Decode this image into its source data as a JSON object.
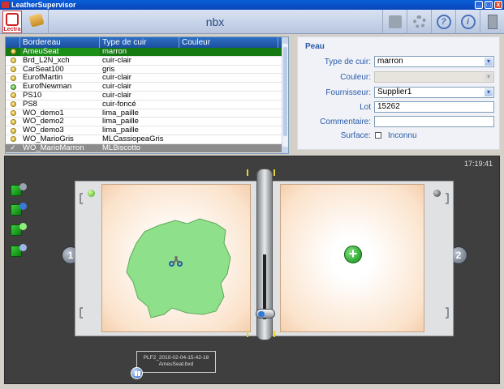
{
  "window": {
    "title": "LeatherSupervisor",
    "min": "_",
    "max": "□",
    "close": "x"
  },
  "header": {
    "logo_text": "Lectra",
    "title": "nbx",
    "icons": [
      "scale-icon",
      "gear-icon",
      "help-icon",
      "info-icon",
      "exit-door-icon"
    ],
    "help_glyph": "?",
    "info_glyph": "i"
  },
  "list": {
    "columns": [
      "Bordereau",
      "Type de cuir",
      "Couleur"
    ],
    "rows": [
      {
        "bordereau": "AmeuSeat",
        "type": "marron",
        "couleur": "",
        "status": "yellow"
      },
      {
        "bordereau": "Brd_L2N_xch",
        "type": "cuir-clair",
        "couleur": "",
        "status": "yellow"
      },
      {
        "bordereau": "CarSeat100",
        "type": "gris",
        "couleur": "",
        "status": "yellow"
      },
      {
        "bordereau": "EurofMartin",
        "type": "cuir-clair",
        "couleur": "",
        "status": "yellow"
      },
      {
        "bordereau": "EurofNewman",
        "type": "cuir-clair",
        "couleur": "",
        "status": "green"
      },
      {
        "bordereau": "PS10",
        "type": "cuir-clair",
        "couleur": "",
        "status": "yellow"
      },
      {
        "bordereau": "PS8",
        "type": "cuir-foncé",
        "couleur": "",
        "status": "yellow"
      },
      {
        "bordereau": "WO_demo1",
        "type": "lima_paille",
        "couleur": "",
        "status": "yellow"
      },
      {
        "bordereau": "WO_demo2",
        "type": "lima_paille",
        "couleur": "",
        "status": "yellow"
      },
      {
        "bordereau": "WO_demo3",
        "type": "lima_paille",
        "couleur": "",
        "status": "yellow"
      },
      {
        "bordereau": "WO_MarioGris",
        "type": "MLCassiopeaGris",
        "couleur": "",
        "status": "yellow"
      },
      {
        "bordereau": "WO_MarioMarron",
        "type": "MLBiscotto",
        "couleur": "",
        "status": "check"
      }
    ],
    "check_glyph": "✓"
  },
  "peau": {
    "title": "Peau",
    "type_label": "Type de cuir:",
    "type_value": "marron",
    "couleur_label": "Couleur:",
    "couleur_value": "",
    "fournisseur_label": "Fournisseur:",
    "fournisseur_value": "Supplier1",
    "lot_label": "Lot",
    "lot_value": "15262",
    "commentaire_label": "Commentaire:",
    "commentaire_value": "",
    "surface_label": "Surface:",
    "surface_value": "Inconnu",
    "dropdown_glyph": "▾"
  },
  "work": {
    "clock": "17:19:41",
    "zone1": "1",
    "zone2": "2",
    "add_glyph": "+",
    "file_line1": "PLF2_2010-02-04-15-42-18",
    "file_line2": "AmeuSeat.bxd"
  },
  "colors": {
    "selected_row": "#167a12",
    "leather_shape": "#8ee08a",
    "accent": "#2a5aa8"
  }
}
